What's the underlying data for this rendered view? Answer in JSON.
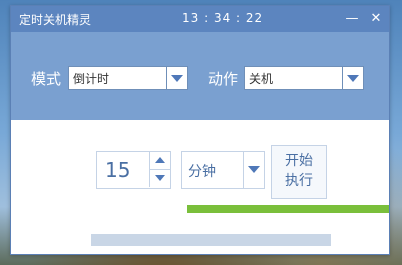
{
  "window": {
    "title": "定时关机精灵",
    "clock": "13 : 34 : 22"
  },
  "controls": {
    "minimize_label": "—",
    "close_label": "✕",
    "mode_label": "模式",
    "mode_value": "倒计时",
    "action_label": "动作",
    "action_value": "关机",
    "time_value": "15",
    "unit_value": "分钟",
    "start_line1": "开始",
    "start_line2": "执行"
  },
  "progress": {
    "fraction": 1.0
  },
  "colors": {
    "titlebar": "#5c85bf",
    "panel": "#7aa0d0",
    "accent": "#4f78b8",
    "progress": "#7abf3b"
  },
  "icons": {
    "minimize": "minimize-icon",
    "close": "close-icon",
    "dropdown": "chevron-down-icon",
    "up": "arrow-up-icon",
    "down": "arrow-down-icon"
  }
}
